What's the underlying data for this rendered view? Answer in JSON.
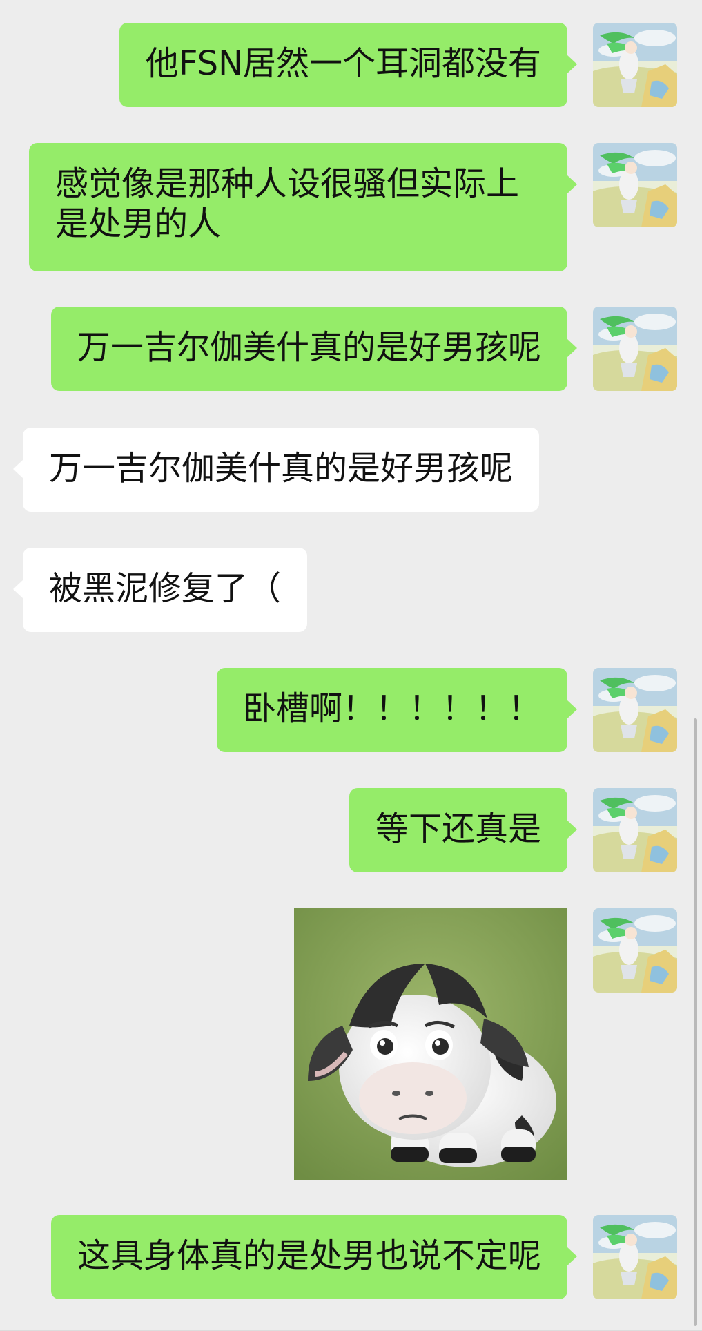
{
  "messages": [
    {
      "text": "他FSN居然一个耳洞都没有"
    },
    {
      "text": "感觉像是那种人设很骚但实际上是处男的人"
    },
    {
      "text": "万一吉尔伽美什真的是好男孩呢"
    },
    {
      "text": "万一吉尔伽美什真的是好男孩呢"
    },
    {
      "text": "被黑泥修复了（"
    },
    {
      "text": "卧槽啊！！！！！！"
    },
    {
      "text": "等下还真是"
    },
    {
      "text": "这具身体真的是处男也说不定呢"
    }
  ],
  "sticker": {
    "icon": "cow-sticker"
  },
  "avatar": {
    "icon": "avatar-green-hair-character"
  },
  "colors": {
    "sent_bubble": "#95ec69",
    "received_bubble": "#ffffff",
    "background": "#ededed"
  }
}
